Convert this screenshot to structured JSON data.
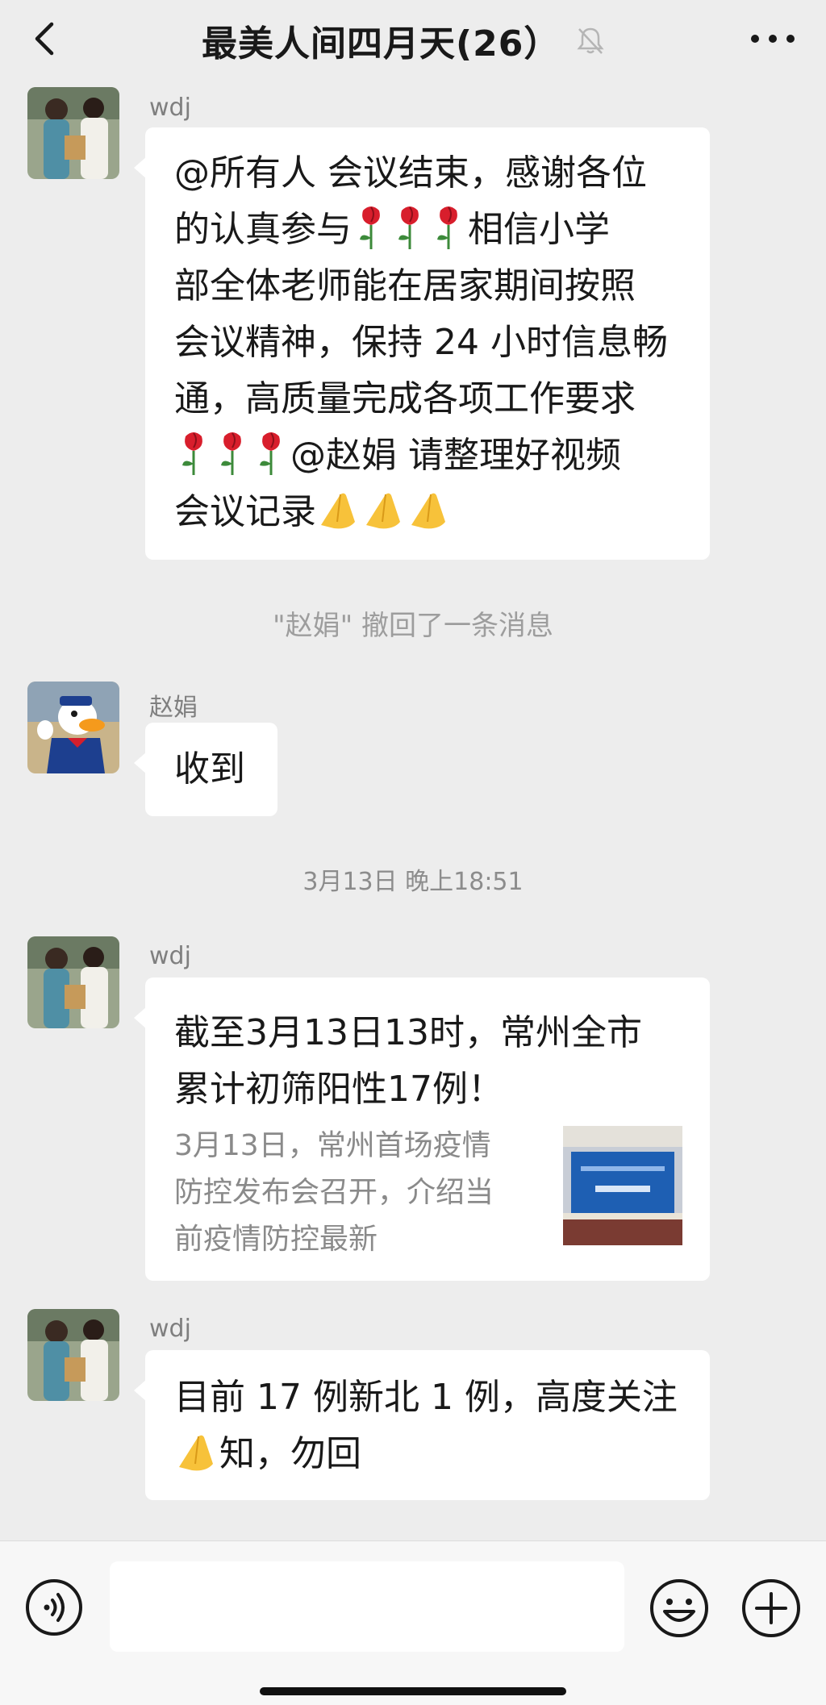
{
  "header": {
    "title": "最美人间四月天(26）",
    "back_icon": "back-chevron-icon",
    "mute_icon": "bell-muted-icon",
    "more_icon": "more-dots-icon"
  },
  "messages": [
    {
      "sender": "wdj",
      "avatar": "avatar-wdj",
      "lines": [
        "@所有人  会议结束，感谢各位",
        "的认真参与",
        "相信小学",
        "部全体老师能在居家期间按照",
        "会议精神，保持 24 小时信息畅",
        "通，高质量完成各项工作要求",
        "@赵娟  请整理好视频",
        "会议记录"
      ]
    },
    {
      "system": "\"赵娟\" 撤回了一条消息"
    },
    {
      "sender": "赵娟",
      "avatar": "avatar-donald-duck",
      "text": "收到"
    },
    {
      "timestamp": "3月13日 晚上18:51"
    },
    {
      "sender": "wdj",
      "avatar": "avatar-wdj",
      "link": {
        "title_line1": "截至3月13日13时，常州全市",
        "title_line2": "累计初筛阳性17例！",
        "desc_line1": "3月13日，常州首场疫情",
        "desc_line2": "防控发布会召开，介绍当",
        "desc_line3": "前疫情防控最新",
        "thumb": "press-conference-thumbnail"
      }
    },
    {
      "sender": "wdj",
      "avatar": "avatar-wdj",
      "line1": "目前 17 例新北 1 例，高度关注",
      "line2": "知，勿回"
    }
  ],
  "input_bar": {
    "voice_icon": "voice-icon",
    "emoji_icon": "emoji-icon",
    "plus_icon": "plus-icon",
    "input_value": ""
  },
  "colors": {
    "background": "#ededed",
    "bubble": "#ffffff",
    "meta_text": "#9d9d9d"
  }
}
